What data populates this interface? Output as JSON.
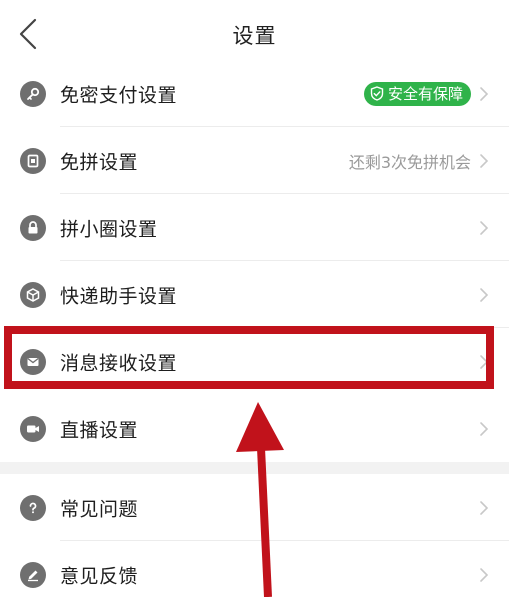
{
  "header": {
    "title": "设置"
  },
  "rows": [
    {
      "label": "免密支付设置",
      "icon": "key-icon",
      "badge": "安全有保障"
    },
    {
      "label": "免拼设置",
      "icon": "card-icon",
      "right_text": "还剩3次免拼机会"
    },
    {
      "label": "拼小圈设置",
      "icon": "lock-icon"
    },
    {
      "label": "快递助手设置",
      "icon": "package-icon"
    },
    {
      "label": "消息接收设置",
      "icon": "envelope-icon"
    },
    {
      "label": "直播设置",
      "icon": "video-camera-icon"
    },
    {
      "label": "常见问题",
      "icon": "question-icon"
    },
    {
      "label": "意见反馈",
      "icon": "pencil-icon"
    }
  ],
  "colors": {
    "highlight": "#c1121b",
    "badge": "#2fb34a",
    "icon_bg": "#6f6f6f"
  }
}
